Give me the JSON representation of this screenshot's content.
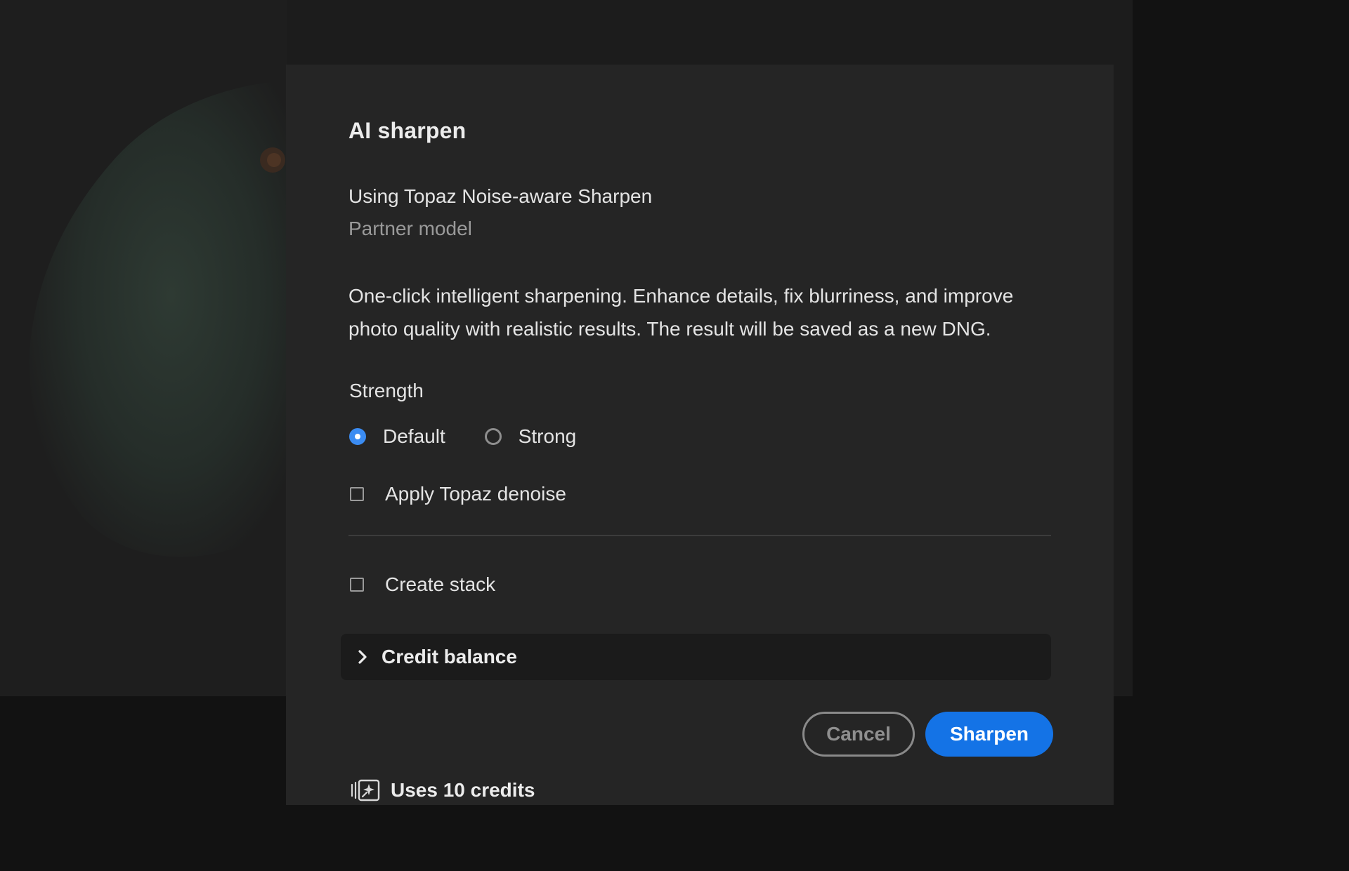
{
  "dialog": {
    "title": "AI sharpen",
    "model_name": "Using Topaz Noise-aware Sharpen",
    "model_sub": "Partner model",
    "description": "One-click intelligent sharpening. Enhance details, fix blurriness, and improve photo quality with realistic results. The result will be saved as a new DNG.",
    "strength": {
      "label": "Strength",
      "options": [
        {
          "label": "Default",
          "selected": true
        },
        {
          "label": "Strong",
          "selected": false
        }
      ]
    },
    "apply_denoise": {
      "label": "Apply Topaz denoise",
      "checked": false
    },
    "create_stack": {
      "label": "Create stack",
      "checked": false
    },
    "credit_balance": {
      "label": "Credit balance",
      "icon": "chevron-right-icon",
      "expanded": false
    },
    "credits_usage": {
      "icon": "credits-icon",
      "text": "Uses 10 credits"
    },
    "cancel_label": "Cancel",
    "primary_label": "Sharpen"
  },
  "colors": {
    "accent": "#1473e6",
    "radio_selected": "#3b8cf2",
    "dialog_bg": "#252525",
    "backdrop": "#121212"
  }
}
